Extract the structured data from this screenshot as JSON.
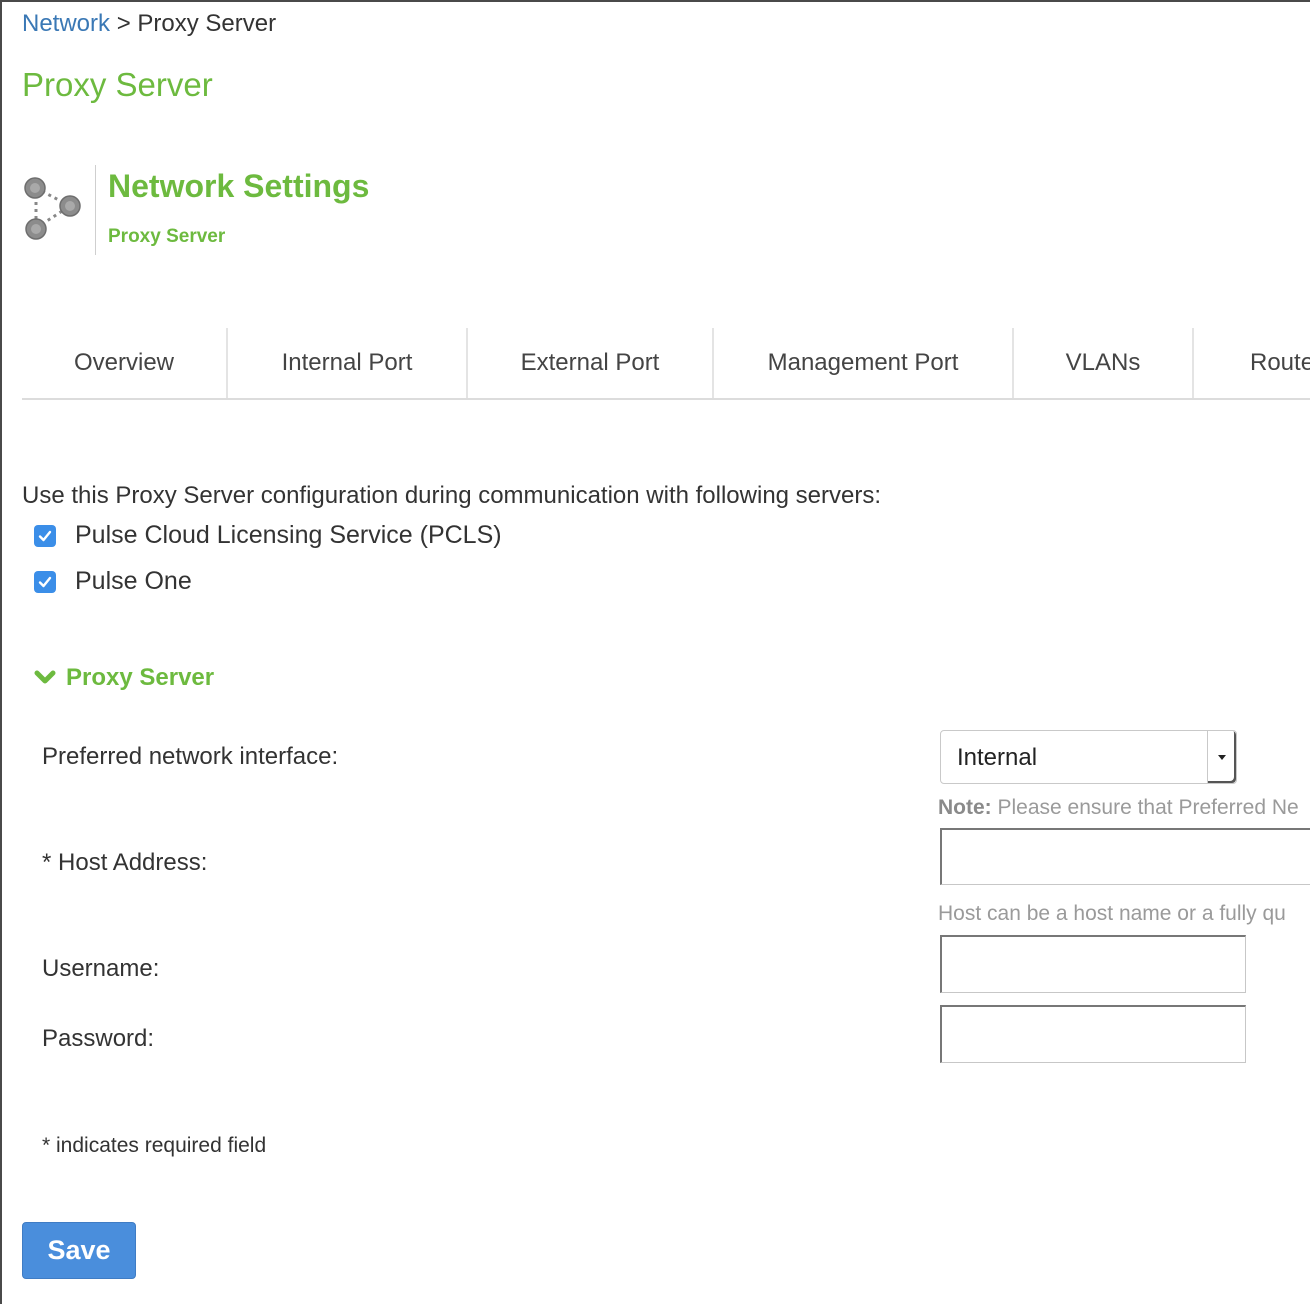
{
  "breadcrumb": {
    "parent": "Network",
    "separator": ">",
    "current": "Proxy Server"
  },
  "page_title": "Proxy Server",
  "header": {
    "icon": "network-nodes-icon",
    "title": "Network Settings",
    "subtitle": "Proxy Server"
  },
  "tabs": [
    {
      "label": "Overview"
    },
    {
      "label": "Internal Port"
    },
    {
      "label": "External Port"
    },
    {
      "label": "Management Port"
    },
    {
      "label": "VLANs"
    },
    {
      "label": "Route"
    }
  ],
  "intro_text": "Use this Proxy Server configuration during communication with following servers:",
  "servers": [
    {
      "label": "Pulse Cloud Licensing Service (PCLS)",
      "checked": true
    },
    {
      "label": "Pulse One",
      "checked": true
    }
  ],
  "section": {
    "icon": "chevron-down-icon",
    "title": "Proxy Server"
  },
  "form": {
    "preferred_interface": {
      "label": "Preferred network interface:",
      "value": "Internal",
      "note_bold": "Note:",
      "note_text": " Please ensure that Preferred Ne"
    },
    "host_address": {
      "label": "* Host Address:",
      "value": "",
      "hint": "Host can be a host name or a fully qu"
    },
    "username": {
      "label": "Username:",
      "value": ""
    },
    "password": {
      "label": "Password:",
      "value": ""
    }
  },
  "required_note": "* indicates required field",
  "save_label": "Save",
  "colors": {
    "accent_green": "#6dba3f",
    "link_blue": "#3a78b5",
    "button_blue": "#4a8edc",
    "checkbox_blue": "#3b8ee8"
  }
}
